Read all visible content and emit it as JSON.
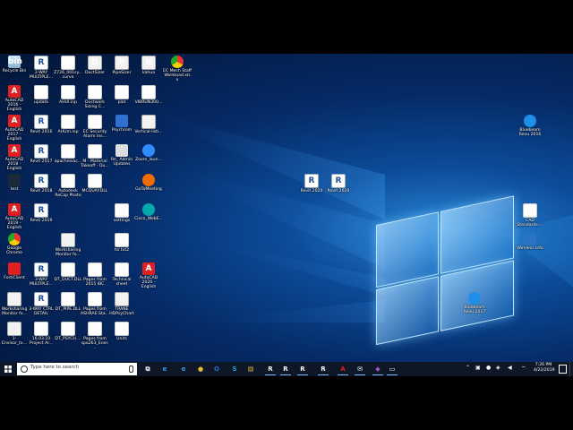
{
  "desktop": {
    "icons": [
      {
        "label": "Recycle Bin",
        "glyph": "bin",
        "kind": "g-bin"
      },
      {
        "label": "2-WAY MULTIPLE...",
        "glyph": "R",
        "kind": "g-revit"
      },
      {
        "label": "Z726_001sy...\ncurve",
        "glyph": "",
        "kind": "g-doc"
      },
      {
        "label": "DuctSizer",
        "glyph": "D",
        "kind": "g-exe"
      },
      {
        "label": "PipeSizer",
        "glyph": "P",
        "kind": "g-exe"
      },
      {
        "label": "kahua",
        "glyph": "K",
        "kind": "g-exe"
      },
      {
        "label": "EC Mech Staff\nWorkload.xlsx",
        "glyph": "",
        "kind": "g-chrome"
      },
      {
        "label": "AutoCAD\n2016 - English",
        "glyph": "A",
        "kind": "g-acad"
      },
      {
        "label": "update",
        "glyph": "",
        "kind": "g-doc"
      },
      {
        "label": "AHUI.inp",
        "glyph": "",
        "kind": "g-doc"
      },
      {
        "label": "Ductwork\nSizing C...",
        "glyph": "",
        "kind": "g-doc"
      },
      {
        "label": "plot",
        "glyph": "",
        "kind": "g-doc"
      },
      {
        "label": "VIBRUN300...",
        "glyph": "",
        "kind": "g-doc"
      },
      {
        "label": "AutoCAD\n2017 - English",
        "glyph": "A",
        "kind": "g-acad"
      },
      {
        "label": "Revit 2016",
        "glyph": "R",
        "kind": "g-revit"
      },
      {
        "label": "AHUm.inp",
        "glyph": "",
        "kind": "g-doc"
      },
      {
        "label": "EC Security\nAlarm Ins...",
        "glyph": "",
        "kind": "g-doc"
      },
      {
        "label": "Psychrom",
        "glyph": "",
        "kind": "g-blue"
      },
      {
        "label": "Vertical-listi...",
        "glyph": "",
        "kind": "g-exe"
      },
      {
        "label": "AutoCAD\n2018 - English",
        "glyph": "A",
        "kind": "g-acad"
      },
      {
        "label": "Revit 2017",
        "glyph": "R",
        "kind": "g-revit"
      },
      {
        "label": "apachelvac...",
        "glyph": "",
        "kind": "g-doc"
      },
      {
        "label": "M - Material\nTakeoff - Du...",
        "glyph": "",
        "kind": "g-doc"
      },
      {
        "label": "Re_ Admin\nUpdates",
        "glyph": "",
        "kind": "g-mail"
      },
      {
        "label": "Zoom_laun...",
        "glyph": "",
        "kind": "g-zoom"
      },
      {
        "label": "test",
        "glyph": "",
        "kind": "g-dark"
      },
      {
        "label": "Revit 2018",
        "glyph": "R",
        "kind": "g-revit"
      },
      {
        "label": "Autodesk\nReCap Photo",
        "glyph": "",
        "kind": "g-doc"
      },
      {
        "label": "MCQUAY.DLL",
        "glyph": "",
        "kind": "g-doc"
      },
      {
        "label": "GoToMeeting",
        "glyph": "",
        "kind": "g-ec"
      },
      {
        "label": "AutoCAD\n2019 - English",
        "glyph": "A",
        "kind": "g-acad"
      },
      {
        "label": "Revit 2019",
        "glyph": "R",
        "kind": "g-revit"
      },
      {
        "label": "settings",
        "glyph": "",
        "kind": "g-doc"
      },
      {
        "label": "Cisco_WebE...",
        "glyph": "",
        "kind": "g-cisco"
      },
      {
        "label": "Google\nChrome",
        "glyph": "",
        "kind": "g-chrome"
      },
      {
        "label": "Worksharing\nMonitor fo...",
        "glyph": "",
        "kind": "g-exe"
      },
      {
        "label": "tsr.txt2",
        "glyph": "",
        "kind": "g-doc"
      },
      {
        "label": "FortiClient",
        "glyph": "",
        "kind": "g-acad"
      },
      {
        "label": "3-WAY\nMULTIPLE...",
        "glyph": "R",
        "kind": "g-revit"
      },
      {
        "label": "DT_DUCT.DLL",
        "glyph": "",
        "kind": "g-doc"
      },
      {
        "label": "Pages from\n2015 IBC",
        "glyph": "",
        "kind": "g-doc"
      },
      {
        "label": "Technical\nsheet",
        "glyph": "",
        "kind": "g-doc"
      },
      {
        "label": "AutoCAD\n2020 - English",
        "glyph": "A",
        "kind": "g-acad"
      },
      {
        "label": "Worksharing\nMonitor fo...",
        "glyph": "",
        "kind": "g-exe"
      },
      {
        "label": "3-WAY CTRL\nDETAIL",
        "glyph": "R",
        "kind": "g-revit"
      },
      {
        "label": "DT_PIPE.DLL",
        "glyph": "",
        "kind": "g-doc"
      },
      {
        "label": "Pages from\nASHRAE Sta...",
        "glyph": "",
        "kind": "g-doc"
      },
      {
        "label": "TRANE\nHDPsyChart",
        "glyph": "",
        "kind": "g-exe"
      },
      {
        "label": "1-Envisor_tx...",
        "glyph": "",
        "kind": "g-exe"
      },
      {
        "label": "16.03.10\nProject Ar...",
        "glyph": "",
        "kind": "g-doc"
      },
      {
        "label": "DT_PSYCH....",
        "glyph": "",
        "kind": "g-doc"
      },
      {
        "label": "Pages from\nspa263_Ener...",
        "glyph": "",
        "kind": "g-doc"
      },
      {
        "label": "Units",
        "glyph": "",
        "kind": "g-doc"
      },
      {
        "label": "Revit 2020",
        "glyph": "R",
        "kind": "g-revit"
      },
      {
        "label": "Revit 2020",
        "glyph": "R",
        "kind": "g-revit"
      },
      {
        "label": "Bluebeam\nRevu 2016",
        "glyph": "",
        "kind": "g-bb"
      },
      {
        "label": "CAD\nStandards-...",
        "glyph": "",
        "kind": "g-doc"
      },
      {
        "label": "Wireless Info",
        "glyph": "",
        "kind": "g-wifi"
      },
      {
        "label": "Bluebeam\nRevu 2017",
        "glyph": "",
        "kind": "g-bb"
      }
    ]
  },
  "taskbar": {
    "search_placeholder": "Type here to search",
    "apps": [
      {
        "name": "task-view",
        "glyph": "⧉",
        "color": "#ffffff"
      },
      {
        "name": "edge",
        "glyph": "e",
        "color": "#3b9be8"
      },
      {
        "name": "ie",
        "glyph": "e",
        "color": "#3b9be8"
      },
      {
        "name": "chrome",
        "glyph": "●",
        "color": "#e8c02c"
      },
      {
        "name": "outlook",
        "glyph": "O",
        "color": "#1f6fc8"
      },
      {
        "name": "skype",
        "glyph": "S",
        "color": "#1aa3e0"
      },
      {
        "name": "file-explorer",
        "glyph": "▤",
        "color": "#f2c440"
      },
      {
        "name": "revit-2018",
        "glyph": "R",
        "color": "#ffffff"
      },
      {
        "name": "revit-2019",
        "glyph": "R",
        "color": "#ffffff"
      },
      {
        "name": "revit-2020",
        "glyph": "R",
        "color": "#ffffff"
      },
      {
        "name": "revit-2017",
        "glyph": "R",
        "color": "#ffffff"
      },
      {
        "name": "autocad",
        "glyph": "A",
        "color": "#e02020"
      },
      {
        "name": "mail",
        "glyph": "✉",
        "color": "#ffffff"
      },
      {
        "name": "visual-studio",
        "glyph": "◆",
        "color": "#9b59d0"
      },
      {
        "name": "notes",
        "glyph": "▭",
        "color": "#ffffff"
      }
    ],
    "clock_time": "7:26 PM",
    "clock_date": "4/22/2019"
  }
}
